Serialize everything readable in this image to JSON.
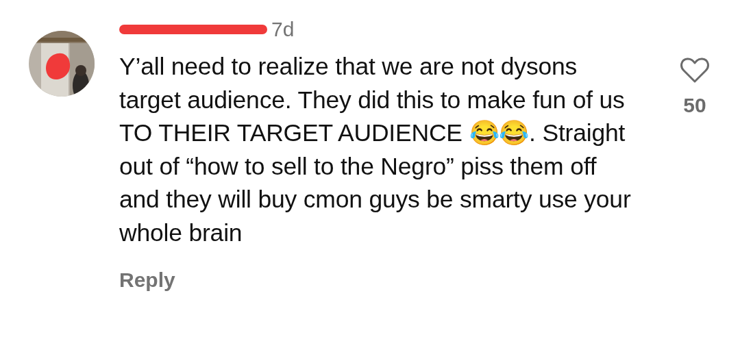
{
  "comment": {
    "time": "7d",
    "text": "Y’all need to realize that we are not dysons target audience. They did this to make fun of us TO THEIR TARGET AUDIENCE 😂😂. Straight out of “how to sell to the Negro” piss them off and they will buy cmon guys be smarty use your whole brain",
    "reply_label": "Reply",
    "likes": "50",
    "liked": false
  }
}
